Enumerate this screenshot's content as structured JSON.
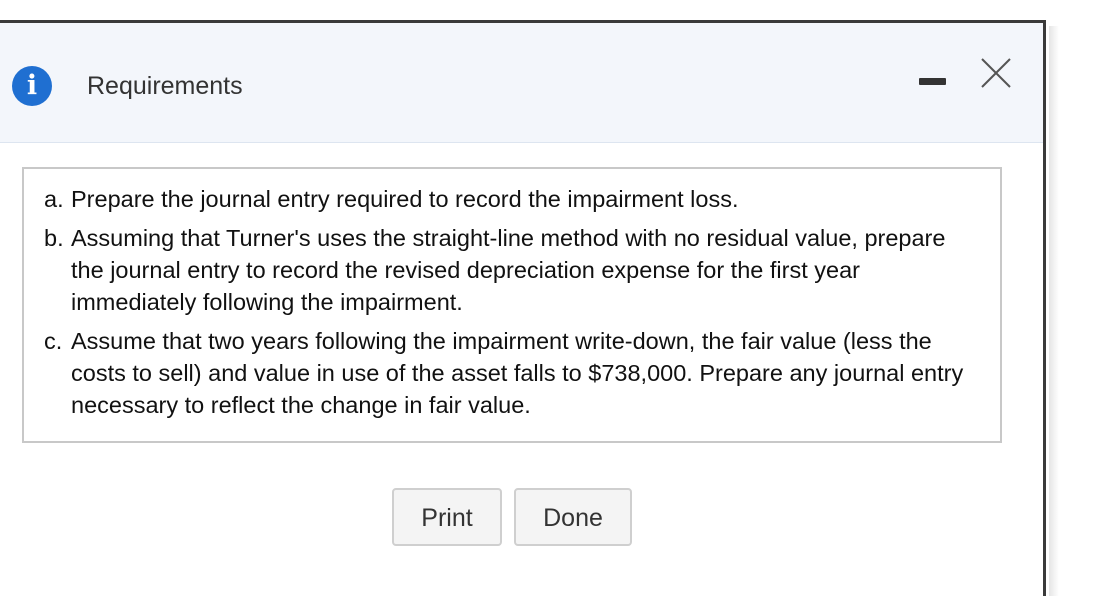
{
  "dialog": {
    "title": "Requirements",
    "info_icon_glyph": "i",
    "icons": {
      "info": "info-icon",
      "minimize": "minimize-icon",
      "close": "close-icon"
    }
  },
  "requirements": [
    {
      "letter": "a.",
      "text": "Prepare the journal entry required to record the impairment loss."
    },
    {
      "letter": "b.",
      "text": "Assuming that Turner's uses the straight-line method with no residual value, prepare the journal entry to record the revised depreciation expense for the first year immediately following the impairment."
    },
    {
      "letter": "c.",
      "text": "Assume that two years following the impairment write-down, the fair value (less the costs to sell) and value in use of the asset falls to $738,000. Prepare any journal entry necessary to reflect the change in fair value."
    }
  ],
  "buttons": {
    "print_label": "Print",
    "done_label": "Done"
  },
  "colors": {
    "accent": "#1f6fd1",
    "header_bg": "#f3f6fb",
    "button_bg": "#f4f4f4"
  }
}
